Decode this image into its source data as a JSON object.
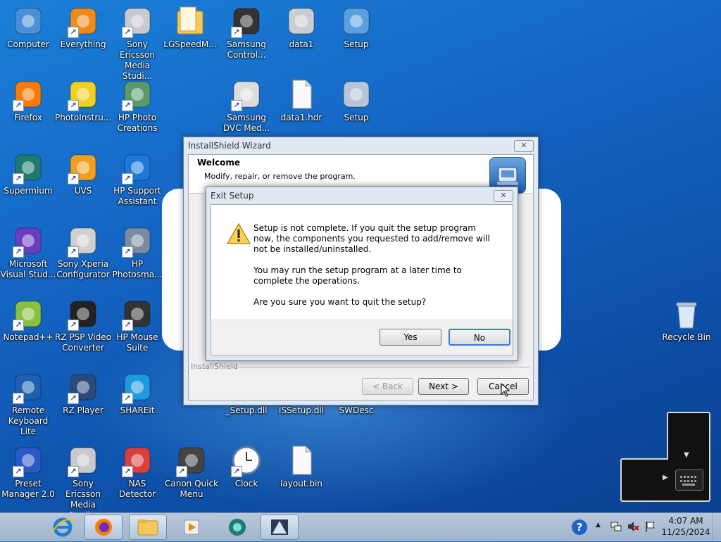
{
  "desktop": {
    "icons": [
      {
        "label": "Computer",
        "icon": "computer-icon"
      },
      {
        "label": "Everything",
        "icon": "everything-icon"
      },
      {
        "label": "Sony Ericsson Media Studi...",
        "icon": "media-studio-icon"
      },
      {
        "label": "LGSpeedM...",
        "icon": "folder-icon"
      },
      {
        "label": "Samsung Control...",
        "icon": "samsung-control-icon"
      },
      {
        "label": "data1",
        "icon": "archive-icon"
      },
      {
        "label": "Setup",
        "icon": "setup-icon"
      },
      {
        "label": "Firefox",
        "icon": "firefox-icon"
      },
      {
        "label": "PhotoInstru...",
        "icon": "photoinstrument-icon"
      },
      {
        "label": "HP Photo Creations",
        "icon": "hp-photo-creations-icon"
      },
      {
        "label": "Samsung DVC Med...",
        "icon": "samsung-dvc-icon"
      },
      {
        "label": "data1.hdr",
        "icon": "file-icon"
      },
      {
        "label": "Setup",
        "icon": "setup-gear-icon"
      },
      {
        "label": "Supermium",
        "icon": "supermium-icon"
      },
      {
        "label": "UVS",
        "icon": "uvs-icon"
      },
      {
        "label": "HP Support Assistant",
        "icon": "hp-support-icon"
      },
      {
        "label": "Microsoft Visual Stud...",
        "icon": "visual-studio-icon"
      },
      {
        "label": "Sony Xperia Configurator",
        "icon": "xperia-icon"
      },
      {
        "label": "HP Photosma...",
        "icon": "hp-photosmart-icon"
      },
      {
        "label": "Notepad++",
        "icon": "notepadpp-icon"
      },
      {
        "label": "RZ PSP Video Converter",
        "icon": "psp-converter-icon"
      },
      {
        "label": "HP Mouse Suite",
        "icon": "mouse-icon"
      },
      {
        "label": "Remote Keyboard Lite",
        "icon": "keyboard-icon"
      },
      {
        "label": "RZ Player",
        "icon": "player-icon"
      },
      {
        "label": "SHAREit",
        "icon": "shareit-icon"
      },
      {
        "label": "_Setup.dll",
        "icon": "dll-icon"
      },
      {
        "label": "ISSetup.dll",
        "icon": "dll-icon"
      },
      {
        "label": "SWDesc",
        "icon": "file-icon"
      },
      {
        "label": "Preset Manager 2.0",
        "icon": "preset-manager-icon"
      },
      {
        "label": "Sony Ericsson Media Studi...",
        "icon": "media-studio-icon"
      },
      {
        "label": "NAS Detector",
        "icon": "nas-icon"
      },
      {
        "label": "Canon Quick Menu",
        "icon": "canon-icon"
      },
      {
        "label": "Clock",
        "icon": "clock-icon"
      },
      {
        "label": "layout.bin",
        "icon": "file-icon"
      },
      {
        "label": "Recycle Bin",
        "icon": "recycle-bin-icon"
      }
    ]
  },
  "installshield": {
    "title": "InstallShield Wizard",
    "header_title": "Welcome",
    "header_subtitle": "Modify, repair, or remove the program.",
    "footer_brand": "InstallShield",
    "back_label": "< Back",
    "next_label": "Next >",
    "cancel_label": "Cancel"
  },
  "exit_dialog": {
    "title": "Exit Setup",
    "message_1": "Setup is not complete. If you quit the setup program now, the components you requested to add/remove will not be installed/uninstalled.",
    "message_2": "You may run the setup program at a later time to complete the operations.",
    "message_3": "Are you sure you want to quit the setup?",
    "yes_label": "Yes",
    "no_label": "No"
  },
  "taskbar": {
    "time": "4:07 AM",
    "date": "11/25/2024"
  }
}
